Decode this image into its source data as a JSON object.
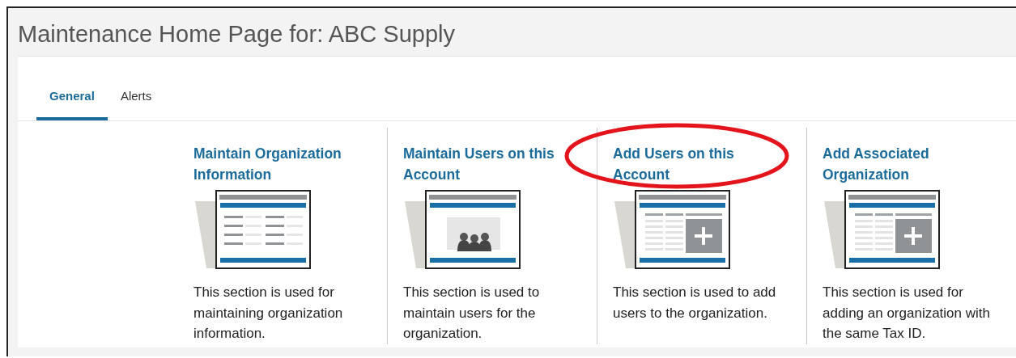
{
  "page": {
    "title": "Maintenance Home Page for: ABC Supply"
  },
  "tabs": [
    {
      "label": "General",
      "selected": true
    },
    {
      "label": "Alerts",
      "selected": false
    }
  ],
  "cards": [
    {
      "title": "Maintain Organization Information",
      "kind": "form",
      "description": "This section is used for maintaining organization information.",
      "circled": false
    },
    {
      "title": "Maintain Users on this Account",
      "kind": "users",
      "description": "This section is used to maintain users for the organization.",
      "circled": false
    },
    {
      "title": "Add Users on this Account",
      "kind": "add",
      "description": "This section is used to add users to the organization.",
      "circled": true
    },
    {
      "title": "Add Associated Organization",
      "kind": "add",
      "description": "This section is used for adding an organization with the same Tax ID.",
      "circled": false
    }
  ]
}
